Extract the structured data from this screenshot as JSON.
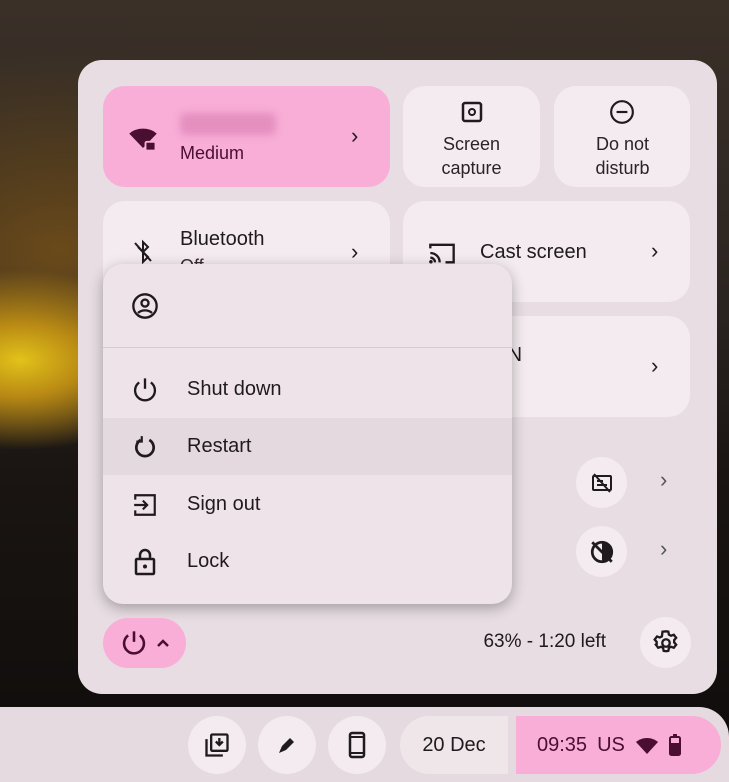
{
  "quick_settings": {
    "network": {
      "name": "",
      "strength": "Medium",
      "active": true
    },
    "screen_capture": {
      "line1": "Screen",
      "line2": "capture"
    },
    "dnd": {
      "line1": "Do not",
      "line2": "disturb"
    },
    "bluetooth": {
      "label": "Bluetooth",
      "status": "Off"
    },
    "cast": {
      "label": "Cast screen"
    },
    "vpn": {
      "label": "VPN"
    },
    "battery": "63% - 1:20 left"
  },
  "power_menu": {
    "items": [
      {
        "label": "Shut down",
        "icon": "power-icon"
      },
      {
        "label": "Restart",
        "icon": "restart-icon",
        "hovered": true
      },
      {
        "label": "Sign out",
        "icon": "sign-out-icon"
      },
      {
        "label": "Lock",
        "icon": "lock-icon"
      }
    ]
  },
  "shelf": {
    "date": "20 Dec",
    "time": "09:35",
    "ime": "US"
  },
  "colors": {
    "accent": "#f8aed7",
    "surface": "#e7dde2",
    "tile": "#f3ebef"
  }
}
